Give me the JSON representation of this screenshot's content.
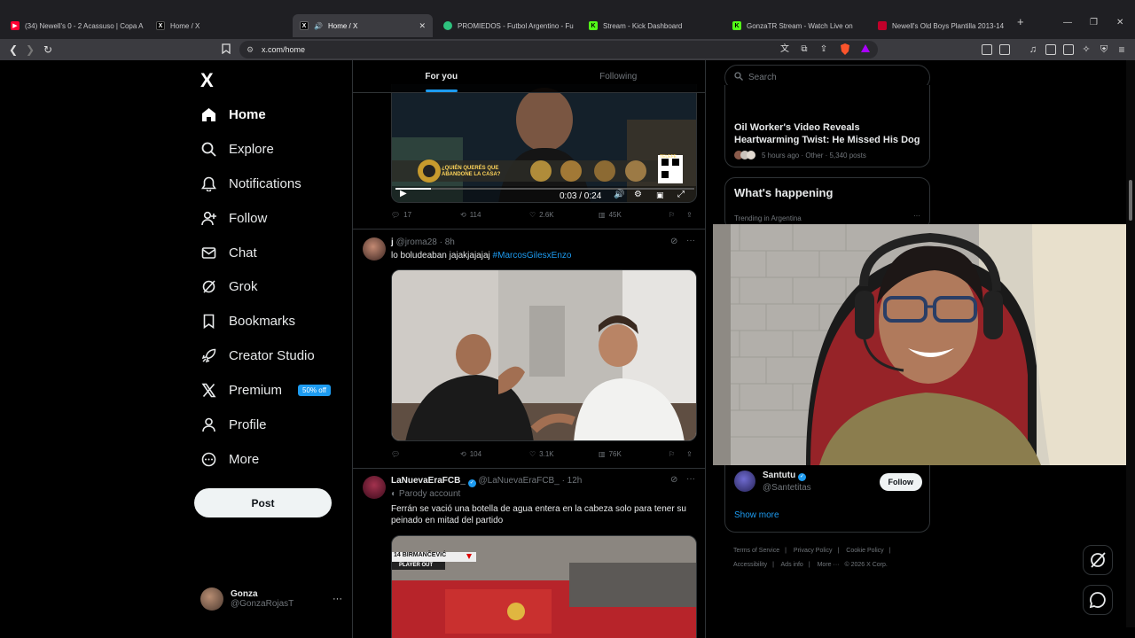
{
  "browser": {
    "tabs": [
      {
        "title": "(34) Newell's 0 - 2 Acassuso | Copa A",
        "favicon_color": "#ff0033",
        "favicon_glyph": "▶"
      },
      {
        "title": "Home / X",
        "favicon_color": "#000000",
        "favicon_glyph": "X"
      },
      {
        "title": "Home / X",
        "favicon_color": "#000000",
        "favicon_glyph": "X",
        "active": true
      },
      {
        "title": "PROMIEDOS - Futbol Argentino - Fu",
        "favicon_color": "#2ec27e",
        "favicon_glyph": "●"
      },
      {
        "title": "Stream - Kick Dashboard",
        "favicon_color": "#53fc18",
        "favicon_glyph": "K"
      },
      {
        "title": "GonzaTR Stream - Watch Live on",
        "favicon_color": "#53fc18",
        "favicon_glyph": "K"
      },
      {
        "title": "Newell's Old Boys Plantilla 2013-14",
        "favicon_color": "#c0002a",
        "favicon_glyph": "■"
      }
    ],
    "new_tab_glyph": "+",
    "url": "x.com/home"
  },
  "sidebar": {
    "logo": "X",
    "items": [
      {
        "label": "Home",
        "icon": "home-icon",
        "active": true
      },
      {
        "label": "Explore",
        "icon": "search-icon"
      },
      {
        "label": "Notifications",
        "icon": "bell-icon"
      },
      {
        "label": "Follow",
        "icon": "follow-icon"
      },
      {
        "label": "Chat",
        "icon": "mail-icon"
      },
      {
        "label": "Grok",
        "icon": "grok-icon"
      },
      {
        "label": "Bookmarks",
        "icon": "bookmark-icon"
      },
      {
        "label": "Creator Studio",
        "icon": "rocket-icon"
      },
      {
        "label": "Premium",
        "icon": "x-icon",
        "badge": "50% off"
      },
      {
        "label": "Profile",
        "icon": "person-icon"
      },
      {
        "label": "More",
        "icon": "more-circle-icon"
      }
    ],
    "post_label": "Post",
    "account": {
      "name": "Gonza",
      "handle": "@GonzaRojasT",
      "menu": "···"
    }
  },
  "feed": {
    "tabs": [
      {
        "label": "For you",
        "active": true
      },
      {
        "label": "Following"
      }
    ],
    "video_tweet": {
      "video_caption": "¿QUIÉN QUERÉS QUE ABANDONE LA CASA?",
      "video_logo": "TELEFE",
      "time": "0:03 / 0:24",
      "replies": "17",
      "reposts": "114",
      "likes": "2.6K",
      "views": "45K"
    },
    "tweet2": {
      "name": "j",
      "handle": "@jroma28",
      "time": "· 8h",
      "text": "lo boludeaban jajakjajajaj",
      "hashtag": "#MarcosGilesxEnzo",
      "replies": "",
      "reposts": "104",
      "likes": "3.1K",
      "views": "76K"
    },
    "tweet3": {
      "name": "LaNuevaEraFCB_",
      "handle": "@LaNuevaEraFCB_",
      "time": "· 12h",
      "label": "Parody account",
      "text": "Ferrán se vació una botella de agua entera en la cabeza solo para tener su peinado en mitad del partido",
      "overlay_name": "14 BIRMANČEVIĆ",
      "overlay_sub": "PLAYER OUT"
    }
  },
  "right": {
    "search_placeholder": "Search",
    "trend_top": {
      "title": "Oil Worker's Video Reveals Heartwarming Twist: He Missed His Dog",
      "meta": "5 hours ago · Other · 5,340 posts"
    },
    "happening": {
      "title": "What's happening",
      "sub": "Trending in Argentina",
      "menu": "···"
    },
    "who_to_follow": {
      "name": "Santutu",
      "handle": "@Santetitas",
      "follow": "Follow",
      "show_more": "Show more"
    },
    "footer": [
      "Terms of Service",
      "|",
      "Privacy Policy",
      "|",
      "Cookie Policy",
      "|",
      "Accessibility",
      "|",
      "Ads info",
      "|",
      "More ···",
      "© 2026 X Corp."
    ]
  },
  "colors": {
    "accent": "#1d9bf0",
    "bg": "#000000",
    "border": "#2f3336",
    "muted": "#71767b"
  }
}
